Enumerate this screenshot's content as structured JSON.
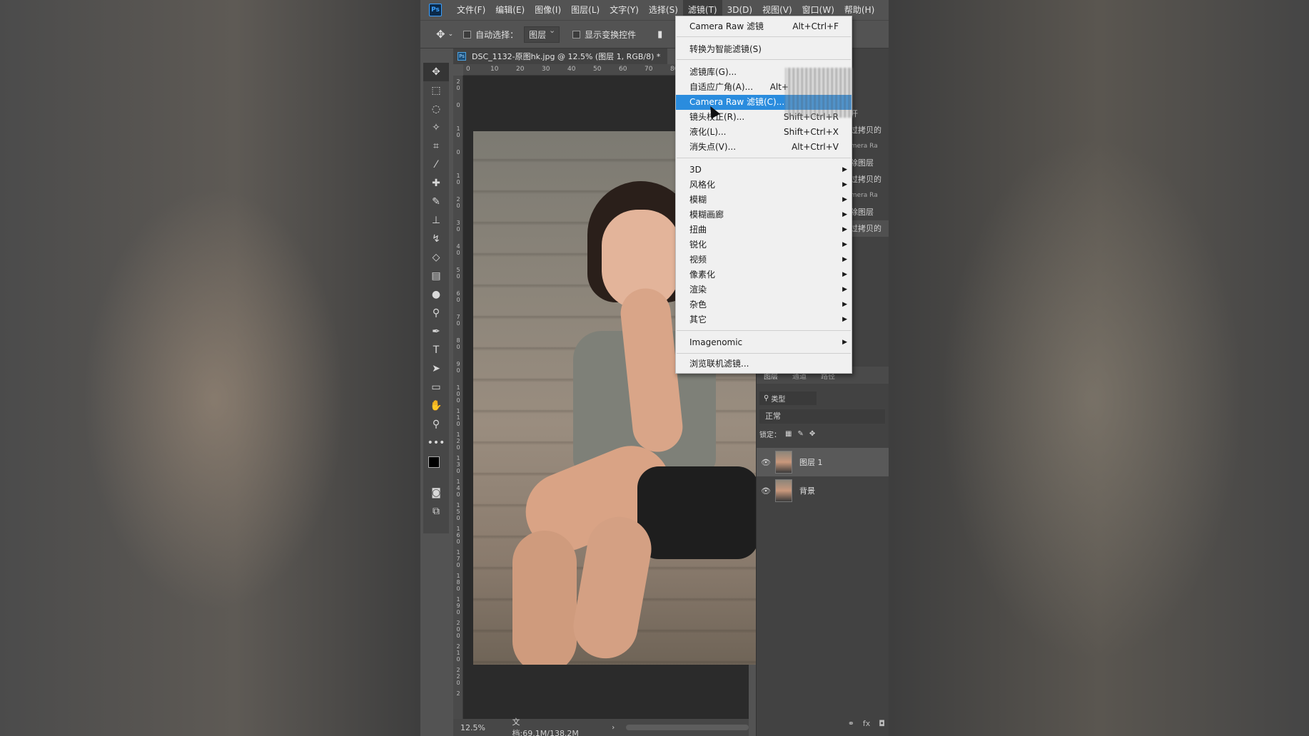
{
  "menubar": {
    "logo": "Ps",
    "items": [
      "文件(F)",
      "编辑(E)",
      "图像(I)",
      "图层(L)",
      "文字(Y)",
      "选择(S)",
      "滤镜(T)",
      "3D(D)",
      "视图(V)",
      "窗口(W)",
      "帮助(H)"
    ],
    "active_index": 6
  },
  "options": {
    "auto_select_label": "自动选择：",
    "auto_select_value": "图层",
    "transform_label": "显示变换控件"
  },
  "document": {
    "tab_title": "DSC_1132-原图hk.jpg @ 12.5% (图层 1, RGB/8) *",
    "ruler_h": [
      "0",
      "10",
      "20",
      "30",
      "40",
      "50",
      "60",
      "70",
      "80"
    ],
    "ruler_v": [
      "2 0",
      "0",
      "1 0",
      "0",
      "1 0",
      "2 0",
      "3 0",
      "4 0",
      "5 0",
      "6 0",
      "7 0",
      "8 0",
      "9 0",
      "1 0 0",
      "1 1 0",
      "1 2 0",
      "1 3 0",
      "1 4 0",
      "1 5 0",
      "1 6 0",
      "1 7 0",
      "1 8 0",
      "1 9 0",
      "2 0 0",
      "2 1 0",
      "2 2 0",
      "2"
    ]
  },
  "status": {
    "zoom": "12.5%",
    "doc_size": "文档:69.1M/138.2M"
  },
  "filter_menu": {
    "items": [
      {
        "label": "Camera Raw 滤镜",
        "shortcut": "Alt+Ctrl+F"
      },
      {
        "label": "转换为智能滤镜(S)",
        "shortcut": ""
      },
      {
        "label": "滤镜库(G)...",
        "shortcut": ""
      },
      {
        "label": "自适应广角(A)...",
        "shortcut": "Alt+"
      },
      {
        "label": "Camera Raw 滤镜(C)...",
        "shortcut": ""
      },
      {
        "label": "镜头校正(R)...",
        "shortcut": "Shift+Ctrl+R"
      },
      {
        "label": "液化(L)...",
        "shortcut": "Shift+Ctrl+X"
      },
      {
        "label": "消失点(V)...",
        "shortcut": "Alt+Ctrl+V"
      },
      {
        "label": "3D",
        "shortcut": ""
      },
      {
        "label": "风格化",
        "shortcut": ""
      },
      {
        "label": "模糊",
        "shortcut": ""
      },
      {
        "label": "模糊画廊",
        "shortcut": ""
      },
      {
        "label": "扭曲",
        "shortcut": ""
      },
      {
        "label": "锐化",
        "shortcut": ""
      },
      {
        "label": "视频",
        "shortcut": ""
      },
      {
        "label": "像素化",
        "shortcut": ""
      },
      {
        "label": "渲染",
        "shortcut": ""
      },
      {
        "label": "杂色",
        "shortcut": ""
      },
      {
        "label": "其它",
        "shortcut": ""
      },
      {
        "label": "Imagenomic",
        "shortcut": ""
      },
      {
        "label": "浏览联机滤镜...",
        "shortcut": ""
      }
    ],
    "highlighted_index": 4
  },
  "history": {
    "items": [
      "打开",
      "通过拷贝的",
      "Camera Ra",
      "删除图层",
      "通过拷贝的",
      "Camera Ra",
      "删除图层",
      "通过拷贝的"
    ]
  },
  "layers": {
    "tabs": [
      "图层",
      "通道",
      "路径"
    ],
    "filter_kind": "类型",
    "blend_mode": "正常",
    "lock_label": "锁定：",
    "rows": [
      {
        "name": "图层 1"
      },
      {
        "name": "背景"
      }
    ]
  }
}
